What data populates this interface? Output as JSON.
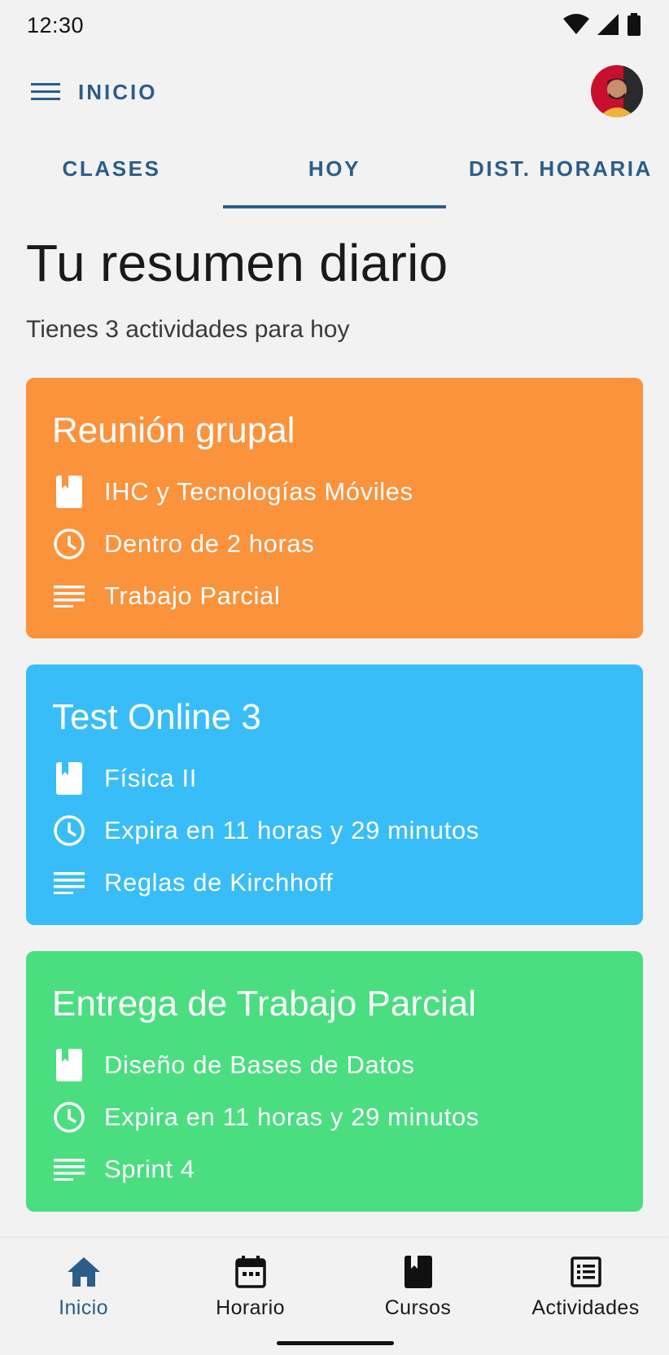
{
  "status_bar": {
    "time": "12:30"
  },
  "header": {
    "title": "INICIO"
  },
  "tabs": [
    {
      "label": "CLASES"
    },
    {
      "label": "HOY",
      "selected": true
    },
    {
      "label": "DIST. HORARIA"
    }
  ],
  "summary": {
    "title": "Tu resumen diario",
    "subtitle": "Tienes 3 actividades para hoy"
  },
  "cards": [
    {
      "title": "Reunión grupal",
      "course": "IHC y Tecnologías Móviles",
      "time": "Dentro de 2 horas",
      "detail": "Trabajo Parcial",
      "color": "#fb923c"
    },
    {
      "title": "Test Online 3",
      "course": "Física II",
      "time": "Expira en 11 horas y 29 minutos",
      "detail": "Reglas de Kirchhoff",
      "color": "#38bdf8"
    },
    {
      "title": "Entrega de Trabajo Parcial",
      "course": "Diseño de Bases de Datos",
      "time": "Expira en 11 horas y 29 minutos",
      "detail": "Sprint 4",
      "color": "#4ade80"
    }
  ],
  "bottom_nav": [
    {
      "label": "Inicio",
      "icon": "home-icon",
      "active": true
    },
    {
      "label": "Horario",
      "icon": "calendar-icon"
    },
    {
      "label": "Cursos",
      "icon": "book-icon"
    },
    {
      "label": "Actividades",
      "icon": "list-alt-icon"
    }
  ],
  "colors": {
    "accent": "#2b5d8a",
    "background": "#f2f2f2"
  }
}
